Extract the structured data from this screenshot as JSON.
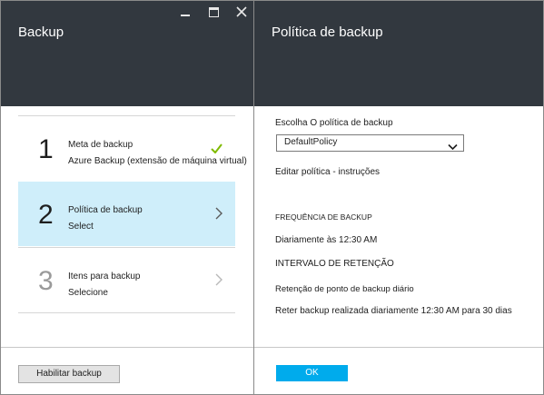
{
  "left_blade": {
    "title": "Backup",
    "steps": [
      {
        "number": "1",
        "title": "Meta de backup",
        "subtitle": "Azure Backup (extensão de máquina virtual)"
      },
      {
        "number": "2",
        "title": "Política de backup",
        "subtitle": "Select"
      },
      {
        "number": "3",
        "title": "Itens para backup",
        "subtitle": "Selecione"
      }
    ],
    "enable_button": "Habilitar backup"
  },
  "right_blade": {
    "title": "Política de backup",
    "choose_label": "Escolha O política de backup",
    "policy_select": "DefaultPolicy",
    "edit_link": "Editar política - instruções",
    "frequency_header": "FREQUÊNCIA DE BACKUP",
    "frequency_value": "Diariamente às 12:30 AM",
    "retention_header": "INTERVALO DE RETENÇÃO",
    "retention_label": "Retenção de ponto de backup diário",
    "retention_value": "Reter backup realizada diariamente 12:30 AM para 30 dias",
    "ok_button": "OK"
  },
  "colors": {
    "header_bg": "#32383f",
    "active_step_bg": "#cfeefa",
    "check_green": "#7fba00",
    "ok_button_bg": "#00abec"
  }
}
